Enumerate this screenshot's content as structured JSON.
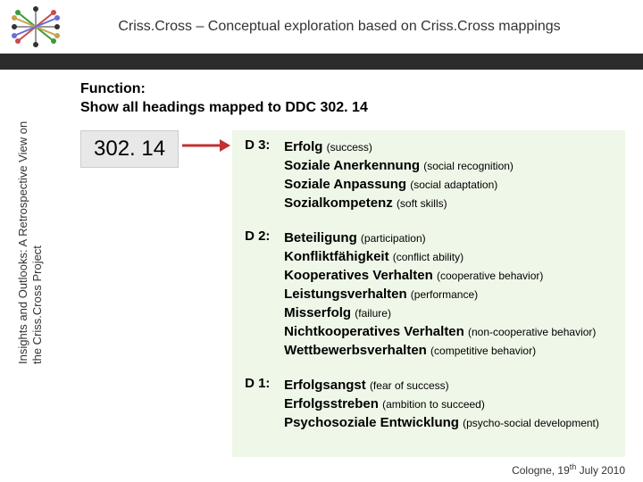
{
  "header": {
    "title": "Criss.Cross – Conceptual exploration based on Criss.Cross mappings"
  },
  "sidebar": {
    "text_line1": "Insights and Outlooks: A Retrospective View on",
    "text_line2": "the Criss.Cross Project"
  },
  "function": {
    "label": "Function:",
    "desc": "Show all headings mapped to DDC 302. 14"
  },
  "code": "302. 14",
  "groups": [
    {
      "label": "D 3:",
      "terms": [
        {
          "de": "Erfolg",
          "en": "(success)"
        },
        {
          "de": "Soziale Anerkennung",
          "en": "(social recognition)"
        },
        {
          "de": "Soziale Anpassung",
          "en": "(social adaptation)"
        },
        {
          "de": "Sozialkompetenz",
          "en": "(soft skills)"
        }
      ]
    },
    {
      "label": "D 2:",
      "terms": [
        {
          "de": "Beteiligung",
          "en": "(participation)"
        },
        {
          "de": "Konfliktfähigkeit",
          "en": "(conflict ability)"
        },
        {
          "de": "Kooperatives Verhalten",
          "en": "(cooperative behavior)"
        },
        {
          "de": "Leistungsverhalten",
          "en": "(performance)"
        },
        {
          "de": "Misserfolg",
          "en": "(failure)"
        },
        {
          "de": "Nichtkooperatives Verhalten",
          "en": "(non-cooperative behavior)"
        },
        {
          "de": "Wettbewerbsverhalten",
          "en": "(competitive behavior)"
        }
      ]
    },
    {
      "label": "D 1:",
      "terms": [
        {
          "de": "Erfolgsangst",
          "en": "(fear of success)"
        },
        {
          "de": "Erfolgsstreben",
          "en": "(ambition to succeed)"
        },
        {
          "de": "Psychosoziale Entwicklung",
          "en": "(psycho-social development)"
        }
      ]
    }
  ],
  "footer": {
    "place": "Cologne, 19",
    "sup": "th",
    "rest": " July 2010"
  }
}
